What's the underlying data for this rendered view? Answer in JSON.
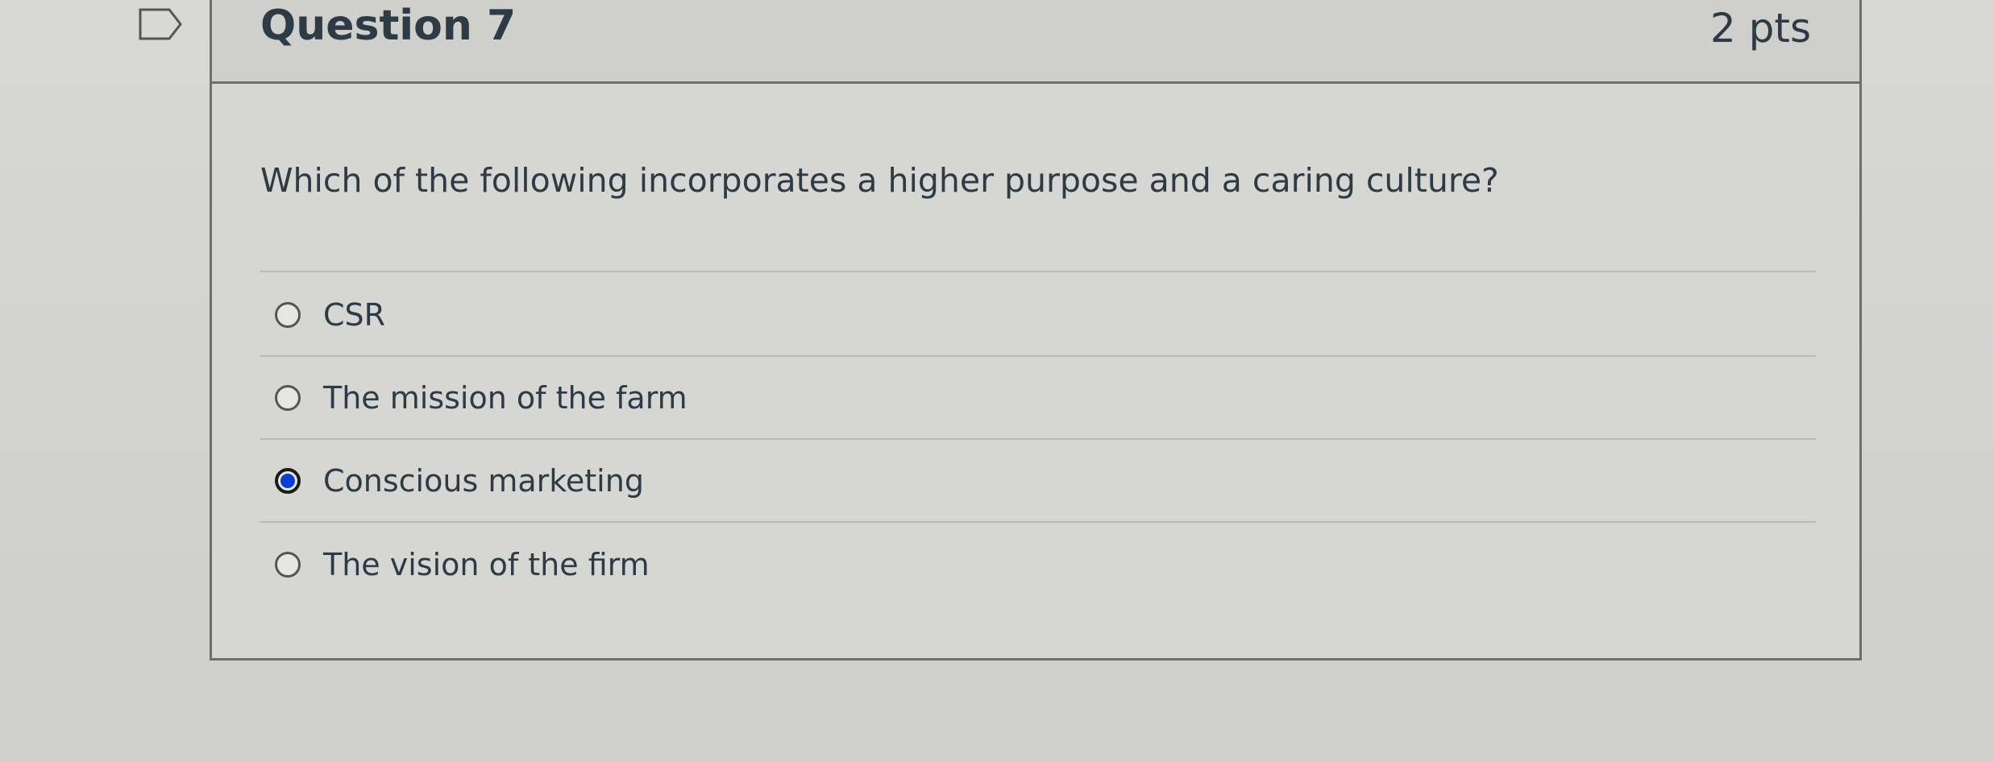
{
  "question": {
    "title": "Question 7",
    "points": "2 pts",
    "text": "Which of the following incorporates a higher purpose and a caring culture?",
    "answers": [
      {
        "label": "CSR",
        "selected": false
      },
      {
        "label": "The mission of the farm",
        "selected": false
      },
      {
        "label": "Conscious marketing",
        "selected": true
      },
      {
        "label": "The vision of the firm",
        "selected": false
      }
    ]
  },
  "icons": {
    "flag": "flag-icon"
  },
  "colors": {
    "text": "#2d3b45",
    "selected_radio": "#0a3fd6",
    "border": "#6e6e6c"
  }
}
